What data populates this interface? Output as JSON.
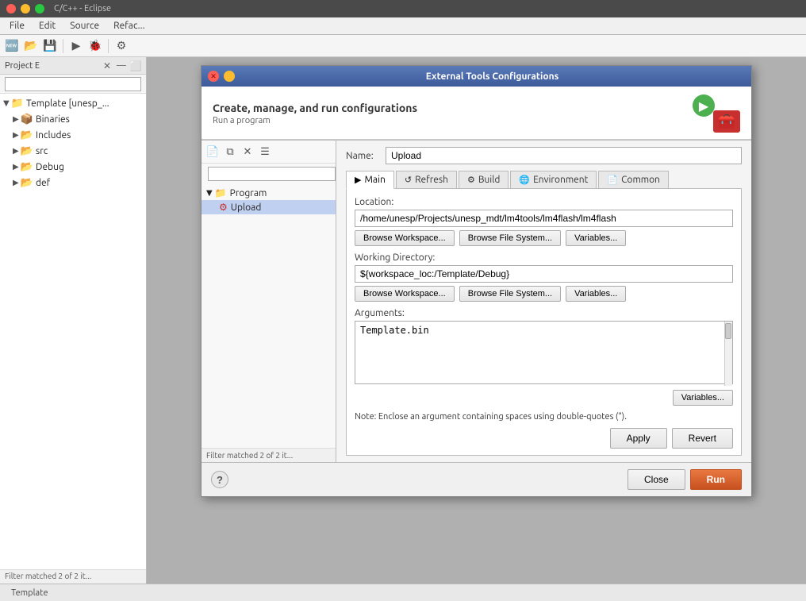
{
  "window": {
    "title": "C/C++ - Eclipse",
    "titlebar_buttons": [
      "close",
      "minimize",
      "maximize"
    ]
  },
  "menubar": {
    "items": [
      "File",
      "Edit",
      "Source",
      "Refac..."
    ]
  },
  "project_explorer": {
    "title": "Project E",
    "search_placeholder": "",
    "tree": [
      {
        "id": "template",
        "label": "Template [unesp_...",
        "level": 0,
        "expanded": true,
        "icon": "project"
      },
      {
        "id": "binaries",
        "label": "Binaries",
        "level": 1,
        "expanded": false,
        "icon": "folder"
      },
      {
        "id": "includes",
        "label": "Includes",
        "level": 1,
        "expanded": false,
        "icon": "folder"
      },
      {
        "id": "src",
        "label": "src",
        "level": 1,
        "expanded": false,
        "icon": "folder"
      },
      {
        "id": "debug",
        "label": "Debug",
        "level": 1,
        "expanded": false,
        "icon": "folder"
      },
      {
        "id": "def",
        "label": "def",
        "level": 1,
        "expanded": false,
        "icon": "folder"
      }
    ],
    "filter_status": "Filter matched 2 of 2 it..."
  },
  "dialog": {
    "title": "External Tools Configurations",
    "header_title": "Create, manage, and run configurations",
    "header_subtitle": "Run a program",
    "name_label": "Name:",
    "name_value": "Upload",
    "tabs": [
      {
        "id": "main",
        "label": "Main",
        "icon": "▶",
        "active": true
      },
      {
        "id": "refresh",
        "label": "Refresh",
        "icon": "↺",
        "active": false
      },
      {
        "id": "build",
        "label": "Build",
        "icon": "⚙",
        "active": false
      },
      {
        "id": "environment",
        "label": "Environment",
        "icon": "🌐",
        "active": false
      },
      {
        "id": "common",
        "label": "Common",
        "icon": "📄",
        "active": false
      }
    ],
    "left_tree": [
      {
        "id": "program",
        "label": "Program",
        "level": 0,
        "expanded": true,
        "icon": "📁"
      },
      {
        "id": "upload",
        "label": "Upload",
        "level": 1,
        "selected": true,
        "icon": "🔧"
      }
    ],
    "left_filter": "Filter matched 2 of 2 it...",
    "location_label": "Location:",
    "location_value": "/home/unesp/Projects/unesp_mdt/lm4tools/lm4flash/lm4flash",
    "working_dir_label": "Working Directory:",
    "working_dir_value": "${workspace_loc:/Template/Debug}",
    "arguments_label": "Arguments:",
    "arguments_value": "Template.bin",
    "note_text": "Note: Enclose an argument containing spaces using double-quotes (\").",
    "buttons": {
      "browse_workspace1": "Browse Workspace...",
      "browse_filesystem1": "Browse File System...",
      "variables1": "Variables...",
      "browse_workspace2": "Browse Workspace...",
      "browse_filesystem2": "Browse File System...",
      "variables2": "Variables...",
      "variables3": "Variables...",
      "apply": "Apply",
      "revert": "Revert",
      "close": "Close",
      "run": "Run"
    }
  },
  "statusbar": {
    "left": "Template",
    "right": ""
  }
}
